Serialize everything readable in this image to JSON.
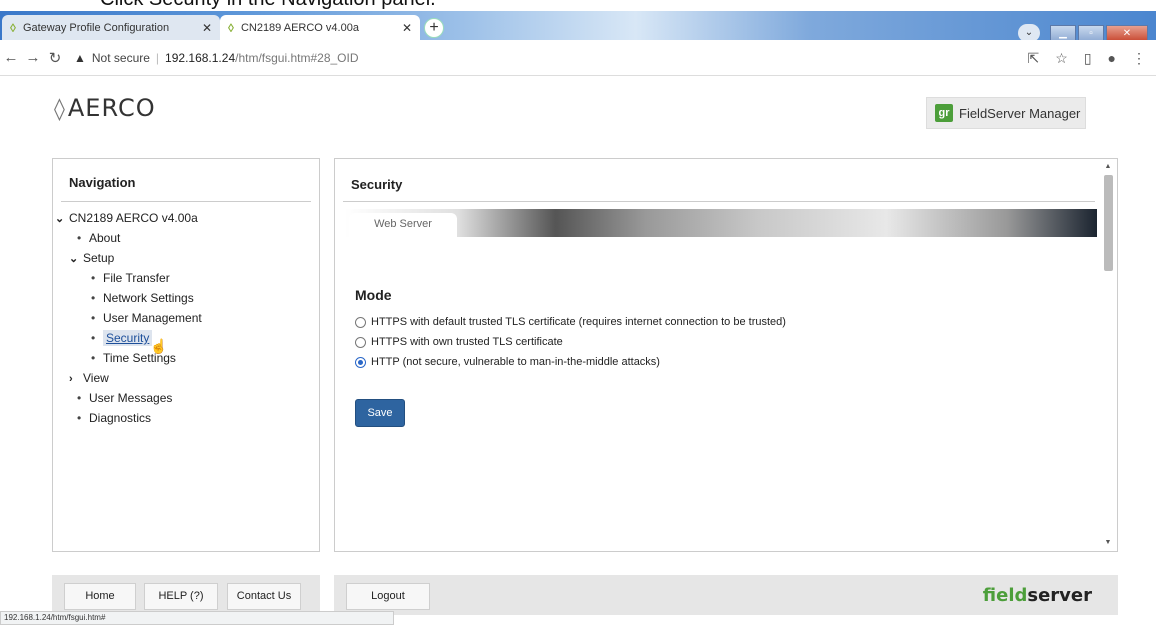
{
  "caption": "Click Security in the Navigation panel.",
  "browser": {
    "tabs": [
      {
        "label": "Gateway Profile Configuration",
        "active": false
      },
      {
        "label": "CN2189 AERCO v4.00a",
        "active": true
      }
    ],
    "security_label": "Not secure",
    "url_host": "192.168.1.24",
    "url_path": "/htm/fsgui.htm#28_OID",
    "status_url": "192.168.1.24/htm/fsgui.htm#"
  },
  "header": {
    "logo_text": "AERCO",
    "fs_manager_label": "FieldServer Manager",
    "fs_manager_badge": "gr"
  },
  "navigation": {
    "title": "Navigation",
    "root": "CN2189 AERCO v4.00a",
    "about": "About",
    "setup": "Setup",
    "setup_items": [
      "File Transfer",
      "Network Settings",
      "User Management",
      "Security",
      "Time Settings"
    ],
    "view": "View",
    "user_messages": "User Messages",
    "diagnostics": "Diagnostics",
    "selected": "Security"
  },
  "content": {
    "title": "Security",
    "tab_label": "Web Server",
    "mode_title": "Mode",
    "options": [
      {
        "label": "HTTPS with default trusted TLS certificate (requires internet connection to be trusted)",
        "checked": false
      },
      {
        "label": "HTTPS with own trusted TLS certificate",
        "checked": false
      },
      {
        "label": "HTTP (not secure, vulnerable to man-in-the-middle attacks)",
        "checked": true
      }
    ],
    "save_label": "Save"
  },
  "footer": {
    "home_label": "Home",
    "help_label": "HELP (?)",
    "contact_label": "Contact Us",
    "logout_label": "Logout",
    "brand_a": "field",
    "brand_b": "server"
  },
  "colors": {
    "accent_blue": "#2e64a0",
    "brand_green": "#4c9e3a"
  }
}
